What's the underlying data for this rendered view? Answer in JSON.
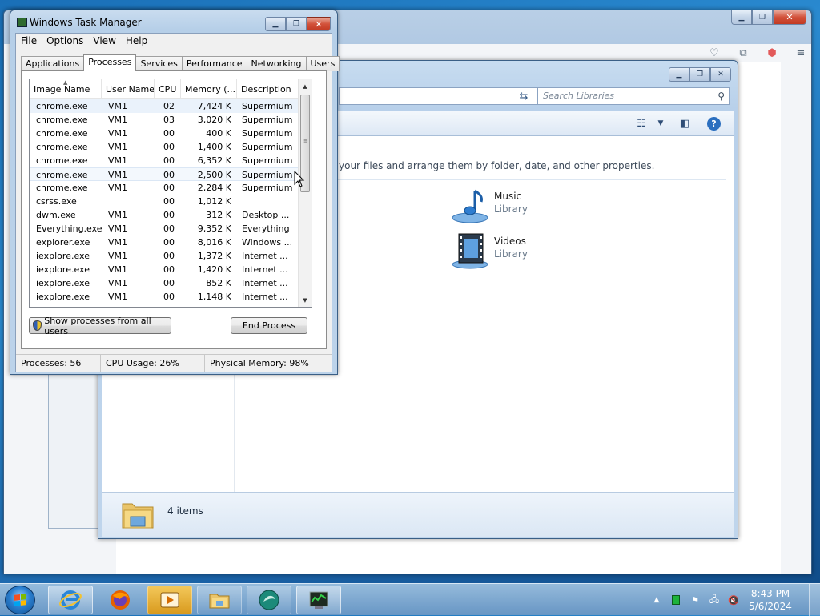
{
  "task_manager": {
    "title": "Windows Task Manager",
    "menu": [
      "File",
      "Options",
      "View",
      "Help"
    ],
    "tabs": [
      "Applications",
      "Processes",
      "Services",
      "Performance",
      "Networking",
      "Users"
    ],
    "active_tab": "Processes",
    "columns": [
      "Image Name",
      "User Name",
      "CPU",
      "Memory (...",
      "Description"
    ],
    "processes": [
      {
        "name": "chrome.exe",
        "user": "VM1",
        "cpu": "02",
        "mem": "7,424 K",
        "desc": "Supermium"
      },
      {
        "name": "chrome.exe",
        "user": "VM1",
        "cpu": "03",
        "mem": "3,020 K",
        "desc": "Supermium"
      },
      {
        "name": "chrome.exe",
        "user": "VM1",
        "cpu": "00",
        "mem": "400 K",
        "desc": "Supermium"
      },
      {
        "name": "chrome.exe",
        "user": "VM1",
        "cpu": "00",
        "mem": "1,400 K",
        "desc": "Supermium"
      },
      {
        "name": "chrome.exe",
        "user": "VM1",
        "cpu": "00",
        "mem": "6,352 K",
        "desc": "Supermium"
      },
      {
        "name": "chrome.exe",
        "user": "VM1",
        "cpu": "00",
        "mem": "2,500 K",
        "desc": "Supermium"
      },
      {
        "name": "chrome.exe",
        "user": "VM1",
        "cpu": "00",
        "mem": "2,284 K",
        "desc": "Supermium"
      },
      {
        "name": "csrss.exe",
        "user": "",
        "cpu": "00",
        "mem": "1,012 K",
        "desc": ""
      },
      {
        "name": "dwm.exe",
        "user": "VM1",
        "cpu": "00",
        "mem": "312 K",
        "desc": "Desktop ..."
      },
      {
        "name": "Everything.exe",
        "user": "VM1",
        "cpu": "00",
        "mem": "9,352 K",
        "desc": "Everything"
      },
      {
        "name": "explorer.exe",
        "user": "VM1",
        "cpu": "00",
        "mem": "8,016 K",
        "desc": "Windows ..."
      },
      {
        "name": "iexplore.exe",
        "user": "VM1",
        "cpu": "00",
        "mem": "1,372 K",
        "desc": "Internet ..."
      },
      {
        "name": "iexplore.exe",
        "user": "VM1",
        "cpu": "00",
        "mem": "1,420 K",
        "desc": "Internet ..."
      },
      {
        "name": "iexplore.exe",
        "user": "VM1",
        "cpu": "00",
        "mem": "852 K",
        "desc": "Internet ..."
      },
      {
        "name": "iexplore.exe",
        "user": "VM1",
        "cpu": "00",
        "mem": "1,148 K",
        "desc": "Internet ..."
      }
    ],
    "show_all_label": "Show processes from all users",
    "end_process_label": "End Process",
    "status": {
      "processes": "Processes: 56",
      "cpu": "CPU Usage: 26%",
      "memory": "Physical Memory: 98%"
    }
  },
  "explorer": {
    "search_placeholder": "Search Libraries",
    "description": "your files and arrange them by folder, date, and other properties.",
    "libraries": [
      {
        "name": "Music",
        "type": "Library"
      },
      {
        "name": "Videos",
        "type": "Library"
      }
    ],
    "item_count": "4 items"
  },
  "taskbar": {
    "time": "8:43 PM",
    "date": "5/6/2024"
  },
  "icons": {
    "tm_app": "task-manager-icon",
    "search": "magnifier-icon",
    "refresh": "refresh-icon",
    "help": "help-icon"
  },
  "colors": {
    "close_red": "#c8452c",
    "selection": "#eaf2fb",
    "taskbar": "#7fa9d1"
  }
}
